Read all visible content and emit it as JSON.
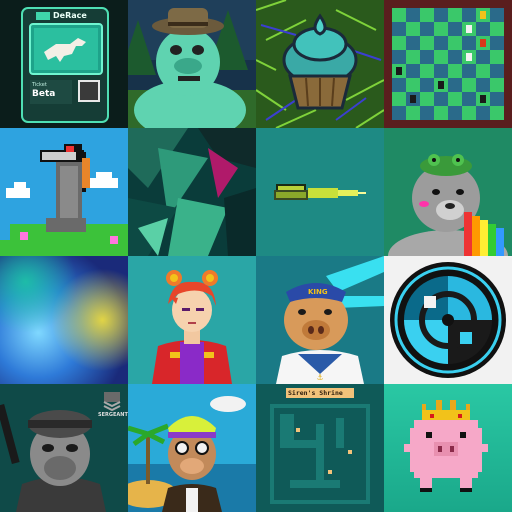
{
  "gallery": {
    "tiles": [
      {
        "icon": "derace-horse-ticket-icon",
        "brand": "DeRace",
        "ticket_label": "Ticket",
        "ticket_value": "Beta"
      },
      {
        "icon": "ranger-hat-monster-icon"
      },
      {
        "icon": "cupcake-icon"
      },
      {
        "icon": "chess-board-icon"
      },
      {
        "icon": "pixel-horse-icon"
      },
      {
        "icon": "abstract-green-icon"
      },
      {
        "icon": "pixel-rocket-icon"
      },
      {
        "icon": "frog-hat-dog-icon"
      },
      {
        "icon": "blurry-gradient-icon"
      },
      {
        "icon": "anime-girl-icon"
      },
      {
        "icon": "sailor-pig-icon",
        "cap_text": "KING"
      },
      {
        "icon": "radial-pattern-icon"
      },
      {
        "icon": "soldier-ape-icon",
        "rank": "SERGEANT"
      },
      {
        "icon": "beach-ape-icon"
      },
      {
        "icon": "pixel-map-icon",
        "title": "Siren's Shrine"
      },
      {
        "icon": "pixel-pig-crown-icon"
      }
    ]
  },
  "colors": {
    "background": "#0b2a2a"
  }
}
